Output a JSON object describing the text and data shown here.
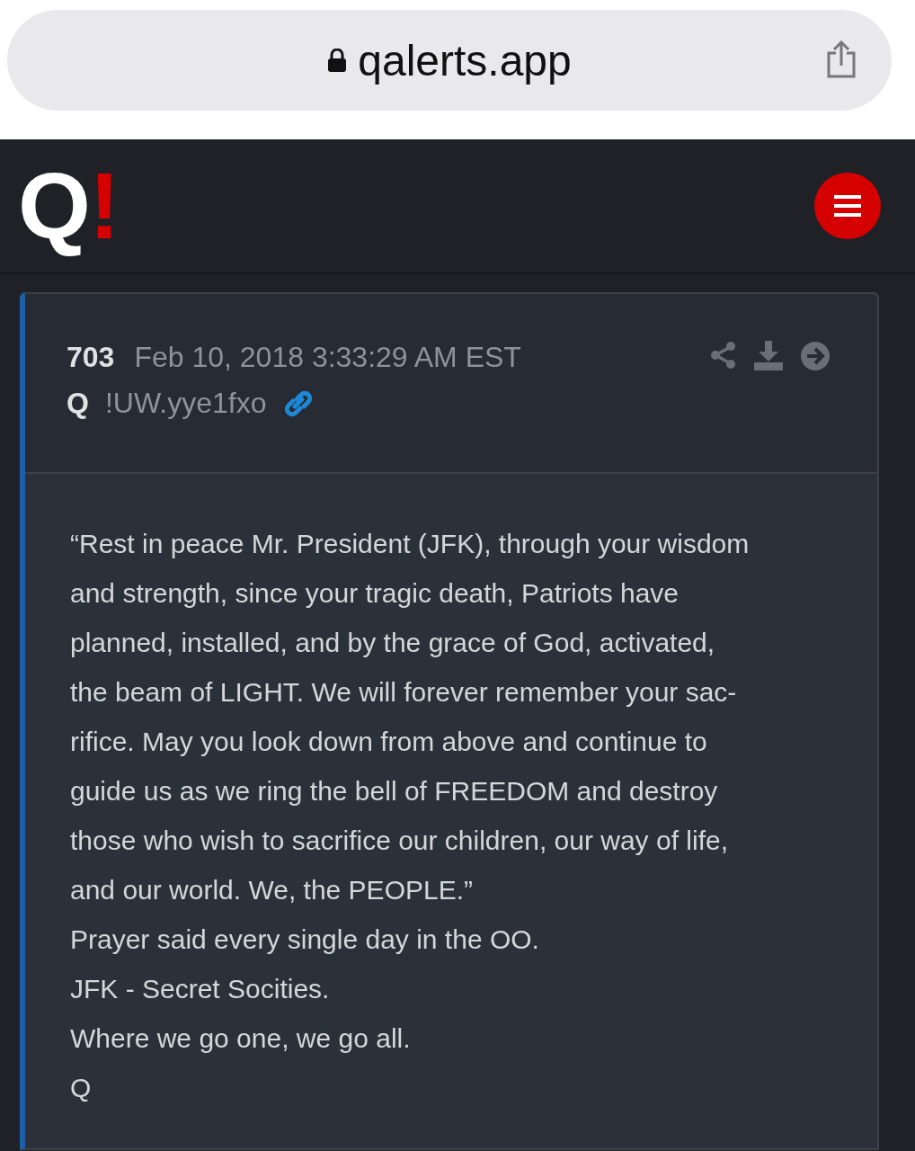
{
  "browser": {
    "url": "qalerts.app"
  },
  "header": {
    "logo_letter": "Q",
    "logo_mark": "!"
  },
  "post": {
    "number": "703",
    "timestamp": "Feb 10, 2018 3:33:29 AM EST",
    "author": "Q",
    "tripcode": "!UW.yye1fxo",
    "quote": "“Rest in peace Mr. President (JFK), through your wisdom\nand strength, since your tragic death, Patriots have\nplanned, installed, and by the grace of God, activated,\nthe beam of LIGHT. We will forever remember your sac-\nrifice. May you look down from above and continue to\nguide us as we ring the bell of FREEDOM and destroy\nthose who wish to sacrifice our children, our way of life,\nand our world. We, the PEOPLE.”",
    "lines": [
      "Prayer said every single day in the OO.",
      "JFK - Secret Socities.",
      "Where we go one, we go all.",
      "Q"
    ]
  }
}
